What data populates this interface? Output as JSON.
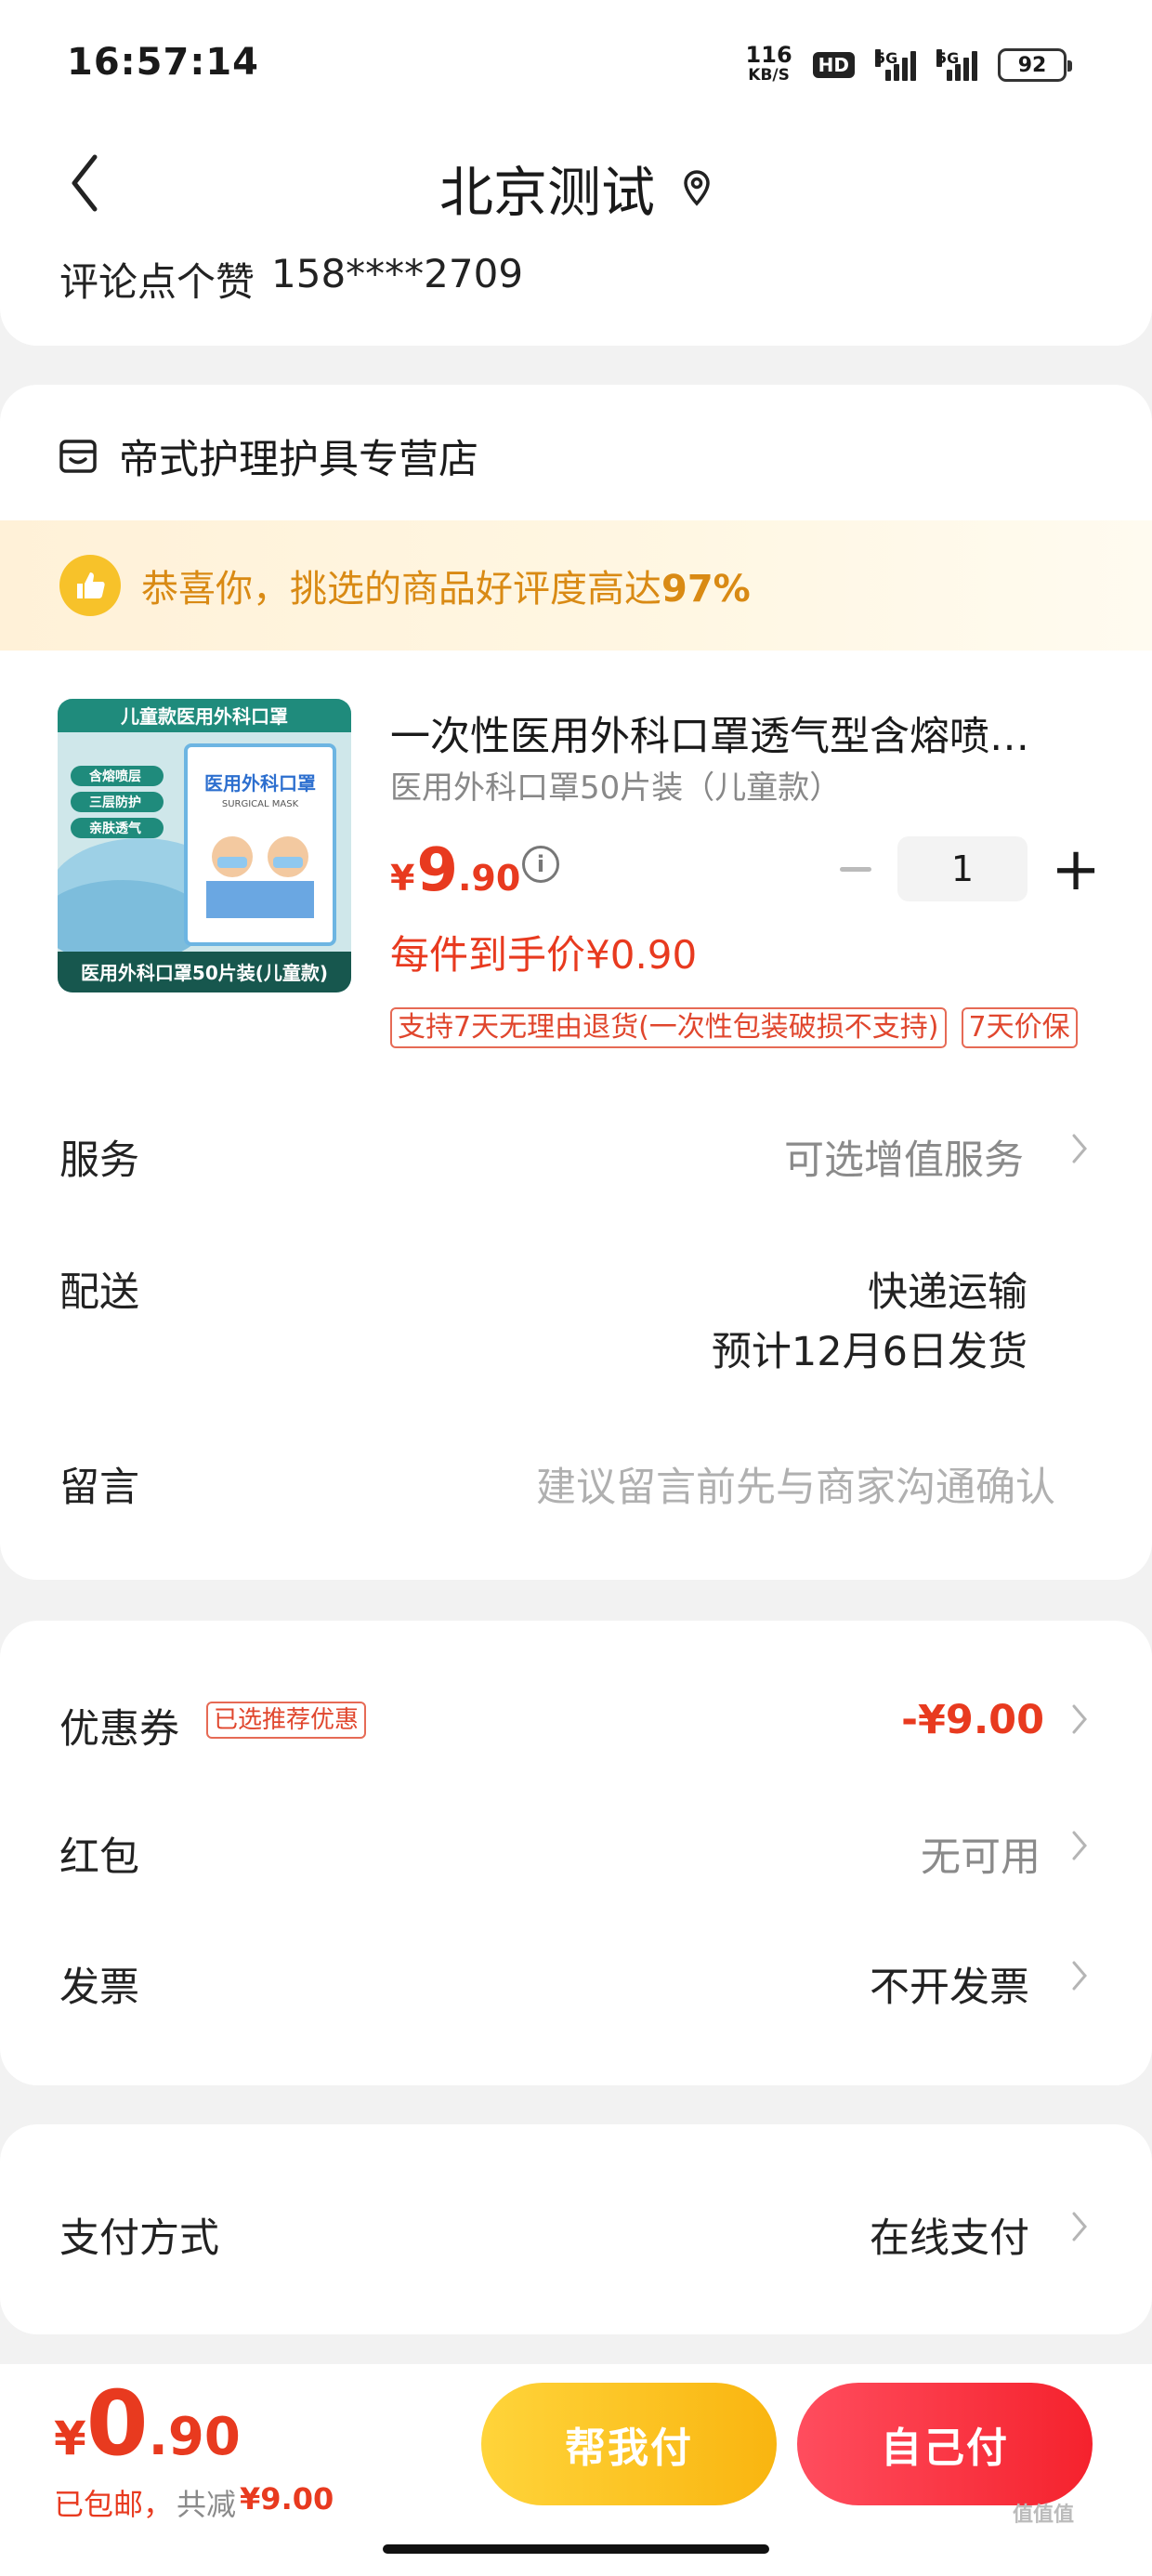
{
  "status_bar": {
    "time": "16:57:14",
    "net_speed_value": "116",
    "net_speed_unit": "KB/S",
    "hd_label": "HD",
    "sim1_label": "5G",
    "sim2_label": "5G",
    "battery": "92"
  },
  "header": {
    "title": "北京测试",
    "user_name": "评论点个赞",
    "user_phone": "158****2709"
  },
  "shop": {
    "name": "帝式护理护具专营店"
  },
  "praise_banner": {
    "text_prefix": "恭喜你，挑选的商品好评度高达",
    "percent": "97%"
  },
  "product": {
    "title": "一次性医用外科口罩透气型含熔喷布防飞沫儿童款",
    "spec": "医用外科口罩50片装（儿童款）",
    "price_currency": "¥",
    "price_int": "9",
    "price_dec": ".90",
    "quantity": "1",
    "unit_price": "每件到手价¥0.90",
    "image_banner": "儿童款医用外科口罩",
    "image_bullets": [
      "含熔喷层",
      "三层防护",
      "亲肤透气"
    ],
    "image_pack_title": "医用外科口罩",
    "image_pack_sub": "SURGICAL MASK",
    "image_caption": "医用外科口罩50片装(儿童款)",
    "tags": [
      "支持7天无理由退货(一次性包装破损不支持)",
      "7天价保"
    ]
  },
  "service": {
    "label": "服务",
    "value": "可选增值服务"
  },
  "delivery": {
    "label": "配送",
    "method": "快递运输",
    "eta": "预计12月6日发货"
  },
  "message": {
    "label": "留言",
    "placeholder": "建议留言前先与商家沟通确认"
  },
  "discounts": {
    "coupon_label": "优惠券",
    "coupon_badge": "已选推荐优惠",
    "coupon_value": "-¥9.00",
    "red_packet_label": "红包",
    "red_packet_value": "无可用",
    "invoice_label": "发票",
    "invoice_value": "不开发票"
  },
  "payment": {
    "label": "支付方式",
    "value": "在线支付"
  },
  "bottom": {
    "total_currency": "¥",
    "total_int": "0",
    "total_dec": ".90",
    "note_shipping": "已包邮，",
    "note_saved_prefix": "共减",
    "note_saved_value": "¥9.00",
    "help_pay_label": "帮我付",
    "self_pay_label": "自己付"
  },
  "watermark": "值值值",
  "colors": {
    "accent_red": "#e83a1f",
    "help_button": "#f9b510",
    "self_button": "#f5222d",
    "praise_text": "#d98a14"
  }
}
